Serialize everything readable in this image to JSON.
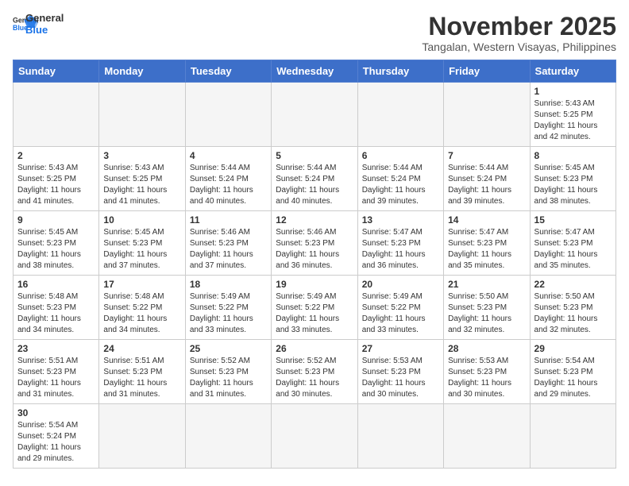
{
  "header": {
    "logo_general": "General",
    "logo_blue": "Blue",
    "month": "November 2025",
    "location": "Tangalan, Western Visayas, Philippines"
  },
  "days_of_week": [
    "Sunday",
    "Monday",
    "Tuesday",
    "Wednesday",
    "Thursday",
    "Friday",
    "Saturday"
  ],
  "weeks": [
    [
      {
        "day": "",
        "info": ""
      },
      {
        "day": "",
        "info": ""
      },
      {
        "day": "",
        "info": ""
      },
      {
        "day": "",
        "info": ""
      },
      {
        "day": "",
        "info": ""
      },
      {
        "day": "",
        "info": ""
      },
      {
        "day": "1",
        "info": "Sunrise: 5:43 AM\nSunset: 5:25 PM\nDaylight: 11 hours and 42 minutes."
      }
    ],
    [
      {
        "day": "2",
        "info": "Sunrise: 5:43 AM\nSunset: 5:25 PM\nDaylight: 11 hours and 41 minutes."
      },
      {
        "day": "3",
        "info": "Sunrise: 5:43 AM\nSunset: 5:25 PM\nDaylight: 11 hours and 41 minutes."
      },
      {
        "day": "4",
        "info": "Sunrise: 5:44 AM\nSunset: 5:24 PM\nDaylight: 11 hours and 40 minutes."
      },
      {
        "day": "5",
        "info": "Sunrise: 5:44 AM\nSunset: 5:24 PM\nDaylight: 11 hours and 40 minutes."
      },
      {
        "day": "6",
        "info": "Sunrise: 5:44 AM\nSunset: 5:24 PM\nDaylight: 11 hours and 39 minutes."
      },
      {
        "day": "7",
        "info": "Sunrise: 5:44 AM\nSunset: 5:24 PM\nDaylight: 11 hours and 39 minutes."
      },
      {
        "day": "8",
        "info": "Sunrise: 5:45 AM\nSunset: 5:23 PM\nDaylight: 11 hours and 38 minutes."
      }
    ],
    [
      {
        "day": "9",
        "info": "Sunrise: 5:45 AM\nSunset: 5:23 PM\nDaylight: 11 hours and 38 minutes."
      },
      {
        "day": "10",
        "info": "Sunrise: 5:45 AM\nSunset: 5:23 PM\nDaylight: 11 hours and 37 minutes."
      },
      {
        "day": "11",
        "info": "Sunrise: 5:46 AM\nSunset: 5:23 PM\nDaylight: 11 hours and 37 minutes."
      },
      {
        "day": "12",
        "info": "Sunrise: 5:46 AM\nSunset: 5:23 PM\nDaylight: 11 hours and 36 minutes."
      },
      {
        "day": "13",
        "info": "Sunrise: 5:47 AM\nSunset: 5:23 PM\nDaylight: 11 hours and 36 minutes."
      },
      {
        "day": "14",
        "info": "Sunrise: 5:47 AM\nSunset: 5:23 PM\nDaylight: 11 hours and 35 minutes."
      },
      {
        "day": "15",
        "info": "Sunrise: 5:47 AM\nSunset: 5:23 PM\nDaylight: 11 hours and 35 minutes."
      }
    ],
    [
      {
        "day": "16",
        "info": "Sunrise: 5:48 AM\nSunset: 5:23 PM\nDaylight: 11 hours and 34 minutes."
      },
      {
        "day": "17",
        "info": "Sunrise: 5:48 AM\nSunset: 5:22 PM\nDaylight: 11 hours and 34 minutes."
      },
      {
        "day": "18",
        "info": "Sunrise: 5:49 AM\nSunset: 5:22 PM\nDaylight: 11 hours and 33 minutes."
      },
      {
        "day": "19",
        "info": "Sunrise: 5:49 AM\nSunset: 5:22 PM\nDaylight: 11 hours and 33 minutes."
      },
      {
        "day": "20",
        "info": "Sunrise: 5:49 AM\nSunset: 5:22 PM\nDaylight: 11 hours and 33 minutes."
      },
      {
        "day": "21",
        "info": "Sunrise: 5:50 AM\nSunset: 5:23 PM\nDaylight: 11 hours and 32 minutes."
      },
      {
        "day": "22",
        "info": "Sunrise: 5:50 AM\nSunset: 5:23 PM\nDaylight: 11 hours and 32 minutes."
      }
    ],
    [
      {
        "day": "23",
        "info": "Sunrise: 5:51 AM\nSunset: 5:23 PM\nDaylight: 11 hours and 31 minutes."
      },
      {
        "day": "24",
        "info": "Sunrise: 5:51 AM\nSunset: 5:23 PM\nDaylight: 11 hours and 31 minutes."
      },
      {
        "day": "25",
        "info": "Sunrise: 5:52 AM\nSunset: 5:23 PM\nDaylight: 11 hours and 31 minutes."
      },
      {
        "day": "26",
        "info": "Sunrise: 5:52 AM\nSunset: 5:23 PM\nDaylight: 11 hours and 30 minutes."
      },
      {
        "day": "27",
        "info": "Sunrise: 5:53 AM\nSunset: 5:23 PM\nDaylight: 11 hours and 30 minutes."
      },
      {
        "day": "28",
        "info": "Sunrise: 5:53 AM\nSunset: 5:23 PM\nDaylight: 11 hours and 30 minutes."
      },
      {
        "day": "29",
        "info": "Sunrise: 5:54 AM\nSunset: 5:23 PM\nDaylight: 11 hours and 29 minutes."
      }
    ],
    [
      {
        "day": "30",
        "info": "Sunrise: 5:54 AM\nSunset: 5:24 PM\nDaylight: 11 hours and 29 minutes."
      },
      {
        "day": "",
        "info": ""
      },
      {
        "day": "",
        "info": ""
      },
      {
        "day": "",
        "info": ""
      },
      {
        "day": "",
        "info": ""
      },
      {
        "day": "",
        "info": ""
      },
      {
        "day": "",
        "info": ""
      }
    ]
  ]
}
